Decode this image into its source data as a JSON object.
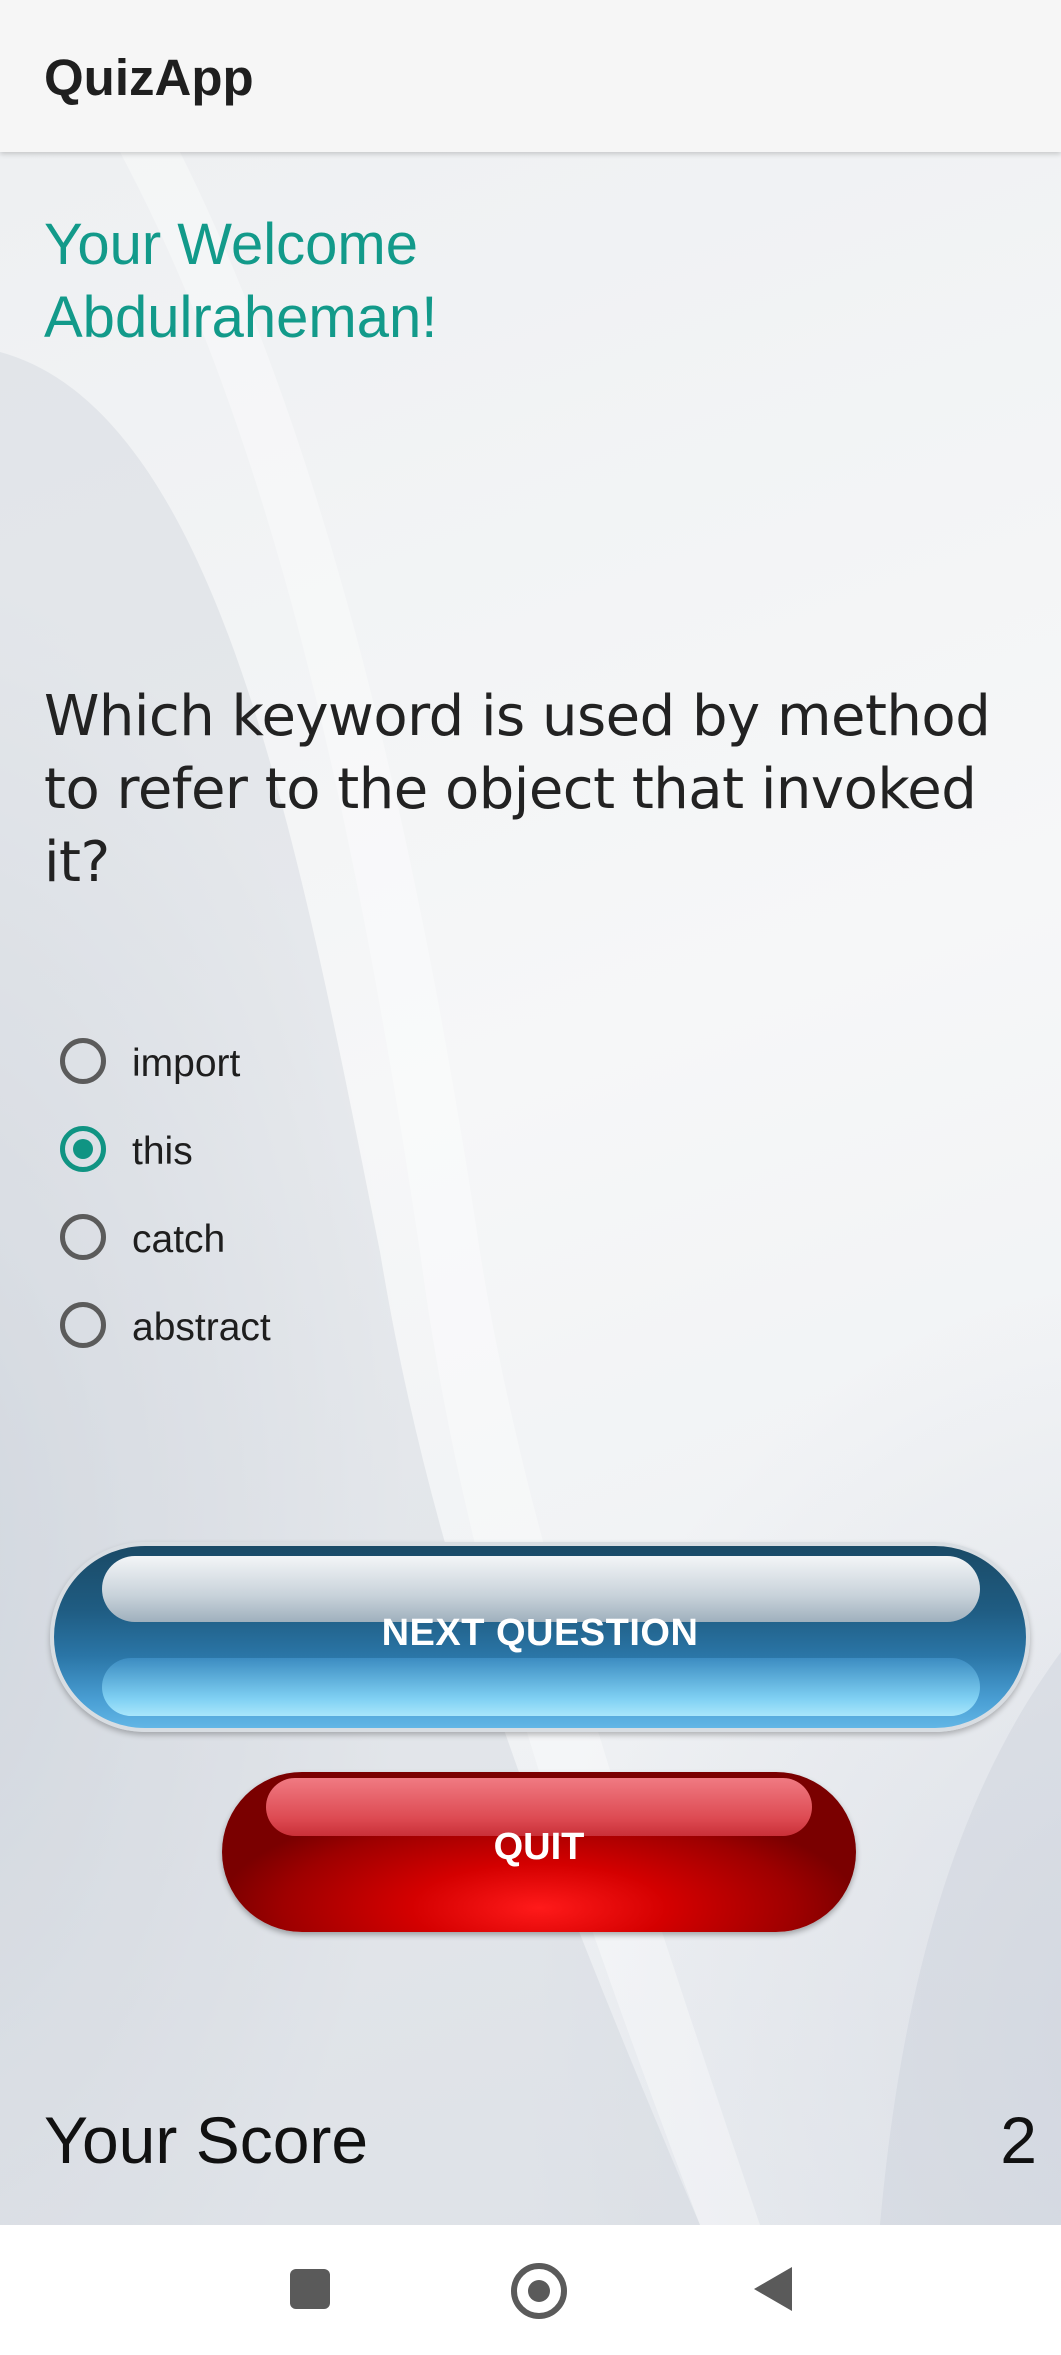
{
  "app": {
    "title": "QuizApp"
  },
  "welcome": {
    "line1": "Your Welcome",
    "line2": "Abdulraheman!"
  },
  "question": {
    "text": "Which keyword is used by method to refer to the object that invoked it?"
  },
  "options": [
    {
      "label": "import",
      "checked": false
    },
    {
      "label": "this",
      "checked": true
    },
    {
      "label": "catch",
      "checked": false
    },
    {
      "label": "abstract",
      "checked": false
    }
  ],
  "buttons": {
    "next_label": "NEXT QUESTION",
    "quit_label": "QUIT"
  },
  "score": {
    "label": "Your Score",
    "value": "2"
  },
  "navigation": {
    "recents_icon": "square-icon",
    "home_icon": "circle-home-icon",
    "back_icon": "triangle-back-icon"
  },
  "colors": {
    "accent": "#129a8a",
    "next_button": "#2a75a6",
    "quit_button": "#d40000"
  }
}
